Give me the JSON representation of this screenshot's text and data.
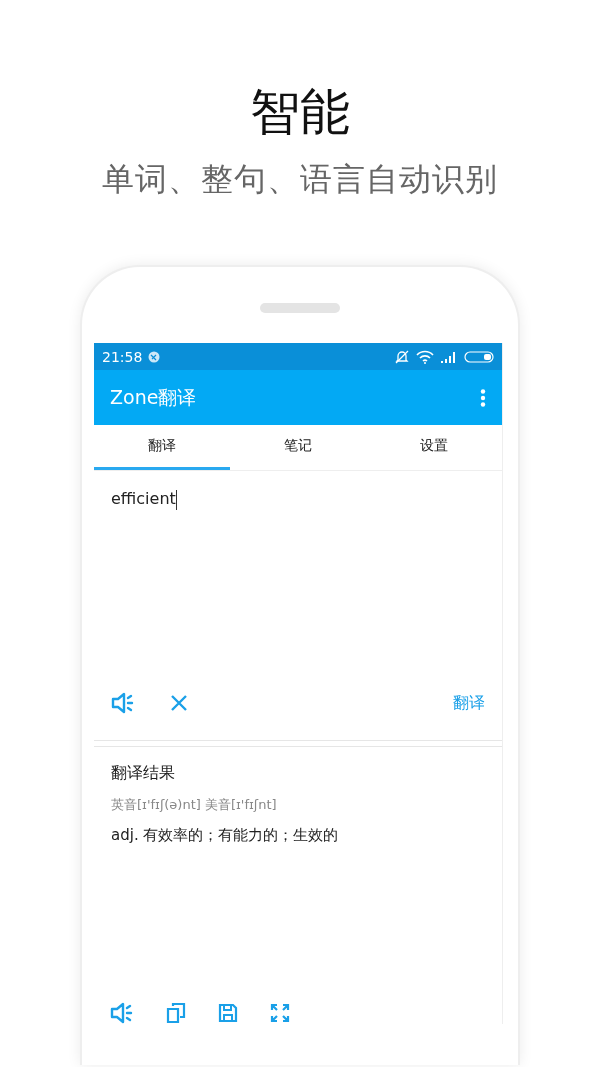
{
  "headline": {
    "title": "智能",
    "subtitle": "单词、整句、语言自动识别"
  },
  "status_bar": {
    "time": "21:58"
  },
  "app_bar": {
    "title": "Zone翻译"
  },
  "tabs": [
    {
      "label": "翻译",
      "selected": true
    },
    {
      "label": "笔记",
      "selected": false
    },
    {
      "label": "设置",
      "selected": false
    }
  ],
  "input": {
    "value": "efficient",
    "translate_button": "翻译"
  },
  "result": {
    "heading": "翻译结果",
    "phonetic": "英音[ɪ'fɪʃ(ə)nt] 美音[ɪ'fɪʃnt]",
    "meaning": "adj. 有效率的；有能力的；生效的"
  }
}
